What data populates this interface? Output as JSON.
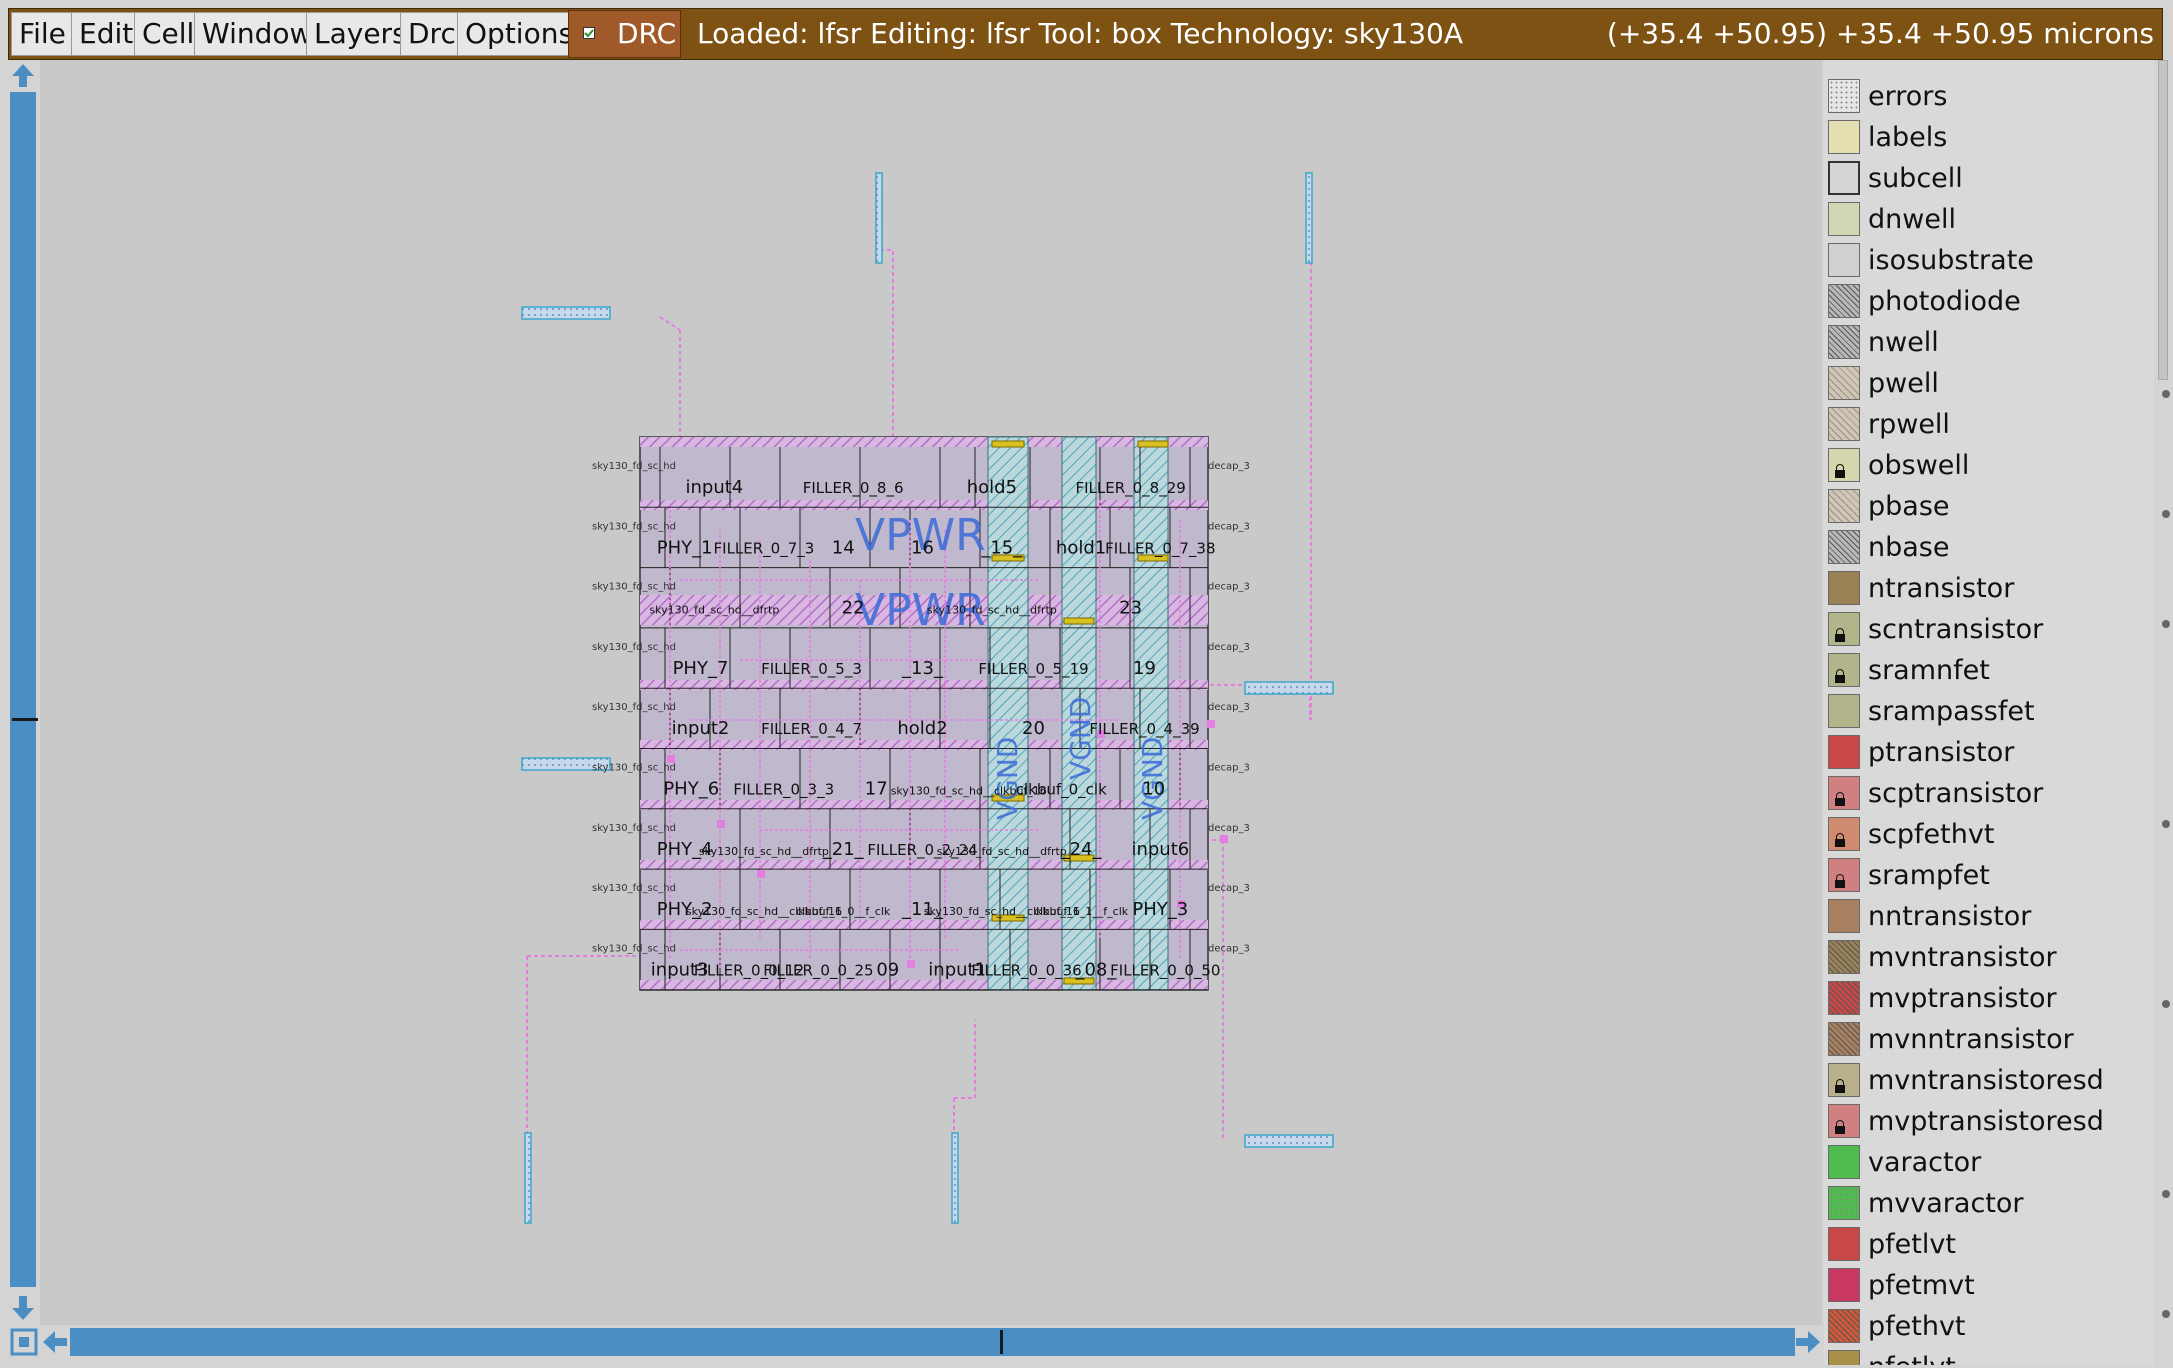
{
  "menus": [
    "File",
    "Edit",
    "Cell",
    "Window",
    "Layers",
    "Drc",
    "Options"
  ],
  "drc": {
    "label": "DRC",
    "checked": true
  },
  "status": "Loaded: lfsr Editing: lfsr Tool: box  Technology: sky130A",
  "coords": "(+35.4 +50.95) +35.4 +50.95 microns",
  "layers": [
    {
      "name": "errors",
      "color": "#e6e6e6",
      "pattern": "dots",
      "locked": false
    },
    {
      "name": "labels",
      "color": "#e4dfb0",
      "pattern": "solid",
      "locked": false
    },
    {
      "name": "subcell",
      "color": "#d4d4d4",
      "pattern": "outline",
      "locked": false
    },
    {
      "name": "dnwell",
      "color": "#d2d6b4",
      "pattern": "solid",
      "locked": false
    },
    {
      "name": "isosubstrate",
      "color": "#d0d0d0",
      "pattern": "solid",
      "locked": false
    },
    {
      "name": "photodiode",
      "color": "#b8b8b8",
      "pattern": "hatch-dark",
      "locked": false
    },
    {
      "name": "nwell",
      "color": "#b8b8b8",
      "pattern": "hatch-dark",
      "locked": false
    },
    {
      "name": "pwell",
      "color": "#cfc6b6",
      "pattern": "hatch-light",
      "locked": false
    },
    {
      "name": "rpwell",
      "color": "#cfc6b6",
      "pattern": "hatch-light",
      "locked": false
    },
    {
      "name": "obswell",
      "color": "#d6d6ae",
      "pattern": "solid",
      "locked": true
    },
    {
      "name": "pbase",
      "color": "#cfc6b6",
      "pattern": "hatch-light",
      "locked": false
    },
    {
      "name": "nbase",
      "color": "#b8b8b8",
      "pattern": "hatch-dark",
      "locked": false
    },
    {
      "name": "ntransistor",
      "color": "#9a8156",
      "pattern": "solid",
      "locked": false
    },
    {
      "name": "scntransistor",
      "color": "#b2b48a",
      "pattern": "solid",
      "locked": true
    },
    {
      "name": "sramnfet",
      "color": "#b2b48a",
      "pattern": "solid",
      "locked": true
    },
    {
      "name": "srampassfet",
      "color": "#b2b48a",
      "pattern": "solid",
      "locked": false
    },
    {
      "name": "ptransistor",
      "color": "#c84848",
      "pattern": "solid",
      "locked": false
    },
    {
      "name": "scptransistor",
      "color": "#d08080",
      "pattern": "solid",
      "locked": true
    },
    {
      "name": "scpfethvt",
      "color": "#d08a70",
      "pattern": "solid",
      "locked": true
    },
    {
      "name": "srampfet",
      "color": "#d08080",
      "pattern": "solid",
      "locked": true
    },
    {
      "name": "nntransistor",
      "color": "#a88060",
      "pattern": "solid",
      "locked": false
    },
    {
      "name": "mvntransistor",
      "color": "#9a8156",
      "pattern": "hatch-dark",
      "locked": false
    },
    {
      "name": "mvptransistor",
      "color": "#c84848",
      "pattern": "hatch-dark",
      "locked": false
    },
    {
      "name": "mvnntransistor",
      "color": "#a88060",
      "pattern": "hatch-dark",
      "locked": false
    },
    {
      "name": "mvntransistoresd",
      "color": "#b8b08a",
      "pattern": "solid",
      "locked": true
    },
    {
      "name": "mvptransistoresd",
      "color": "#d08080",
      "pattern": "solid",
      "locked": true
    },
    {
      "name": "varactor",
      "color": "#4ebc4e",
      "pattern": "solid",
      "locked": false
    },
    {
      "name": "mvvaractor",
      "color": "#4ebc4e",
      "pattern": "dots",
      "locked": false
    },
    {
      "name": "pfetlvt",
      "color": "#c84848",
      "pattern": "solid",
      "locked": false
    },
    {
      "name": "pfetmvt",
      "color": "#c83860",
      "pattern": "solid",
      "locked": false
    },
    {
      "name": "pfethvt",
      "color": "#d05838",
      "pattern": "hatch-dark",
      "locked": false
    },
    {
      "name": "nfetlvt",
      "color": "#a89048",
      "pattern": "solid",
      "locked": false
    }
  ],
  "layout": {
    "top_labels": [
      "VPWR",
      "VPWR"
    ],
    "vertical_labels": [
      "VGND",
      "VGND",
      "VGND"
    ],
    "rows": [
      {
        "left": "sky130_fd_sc_hd",
        "right": "decap_3",
        "cells": [
          "input4",
          "FILLER_0_8_6",
          "hold5",
          "FILLER_0_8_29"
        ]
      },
      {
        "left": "sky130_fd_sc_hd",
        "right": "decap_3",
        "cells": [
          "PHY_1",
          "FILLER_0_7_3",
          "14",
          "16",
          "_15_",
          "hold1",
          "FILLER_0_7_38"
        ]
      },
      {
        "left": "sky130_fd_sc_hd",
        "right": "decap_3",
        "cells": [
          "sky130_fd_sc_hd__dfrtp",
          "22",
          "sky130_fd_sc_hd__dfrtp",
          "23"
        ]
      },
      {
        "left": "sky130_fd_sc_hd",
        "right": "decap_3",
        "cells": [
          "PHY_7",
          "FILLER_0_5_3",
          "_13_",
          "FILLER_0_5_19",
          "19"
        ]
      },
      {
        "left": "sky130_fd_sc_hd",
        "right": "decap_3",
        "cells": [
          "input2",
          "FILLER_0_4_7",
          "hold2",
          "20",
          "FILLER_0_4_39"
        ]
      },
      {
        "left": "sky130_fd_sc_hd",
        "right": "decap_3",
        "cells": [
          "PHY_6",
          "FILLER_0_3_3",
          "17",
          "sky130_fd_sc_hd__clkbuf_16",
          "clkbuf_0_clk",
          "10"
        ]
      },
      {
        "left": "sky130_fd_sc_hd",
        "right": "decap_3",
        "cells": [
          "PHY_4",
          "sky130_fd_sc_hd__dfrtp",
          "_21_",
          "FILLER_0_2_24",
          "sky130_fd_sc_hd__dfrtp",
          "_24_",
          "input6"
        ]
      },
      {
        "left": "sky130_fd_sc_hd",
        "right": "decap_3",
        "cells": [
          "PHY_2",
          "sky130_fd_sc_hd__clkbuf_16",
          "clkbuf_1_0__f_clk",
          "_11_",
          "sky130_fd_sc_hd__clkbuf_16",
          "clkbuf_1_1__f_clk",
          "PHY_3"
        ]
      },
      {
        "left": "sky130_fd_sc_hd",
        "right": "decap_3",
        "cells": [
          "input3",
          "FILLER_0_0_12",
          "FILLER_0_0_25",
          "09",
          "input1",
          "FILLER_0_0_36",
          "_08_",
          "FILLER_0_0_50"
        ]
      }
    ]
  }
}
